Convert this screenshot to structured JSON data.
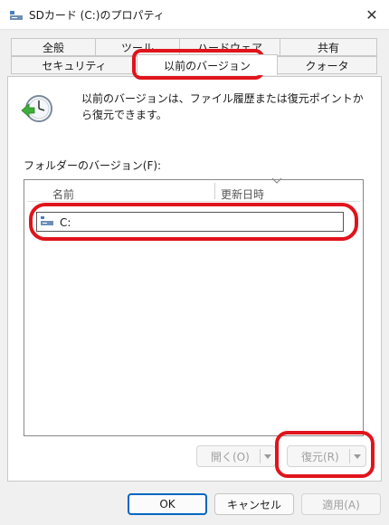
{
  "window": {
    "title": "SDカード (C:)のプロパティ",
    "close_glyph": "✕"
  },
  "tabs": {
    "row_back": [
      "全般",
      "ツール",
      "ハードウェア",
      "共有"
    ],
    "row_front": [
      "セキュリティ",
      "以前のバージョン",
      "クォータ"
    ],
    "active": "以前のバージョン"
  },
  "info": {
    "icon": "history-clock-icon",
    "text": "以前のバージョンは、ファイル履歴または復元ポイントから復元できます。"
  },
  "folder_versions": {
    "label": "フォルダーのバージョン(F):",
    "columns": [
      "名前",
      "更新日時"
    ],
    "rows": [
      {
        "name": "C:",
        "icon": "drive-icon"
      }
    ]
  },
  "actions": {
    "open_label": "開く(O)",
    "restore_label": "復元(R)"
  },
  "footer": {
    "ok_label": "OK",
    "cancel_label": "キャンセル",
    "apply_label": "適用(A)"
  },
  "colors": {
    "annotation": "#e0141c",
    "accent": "#0067c0"
  }
}
